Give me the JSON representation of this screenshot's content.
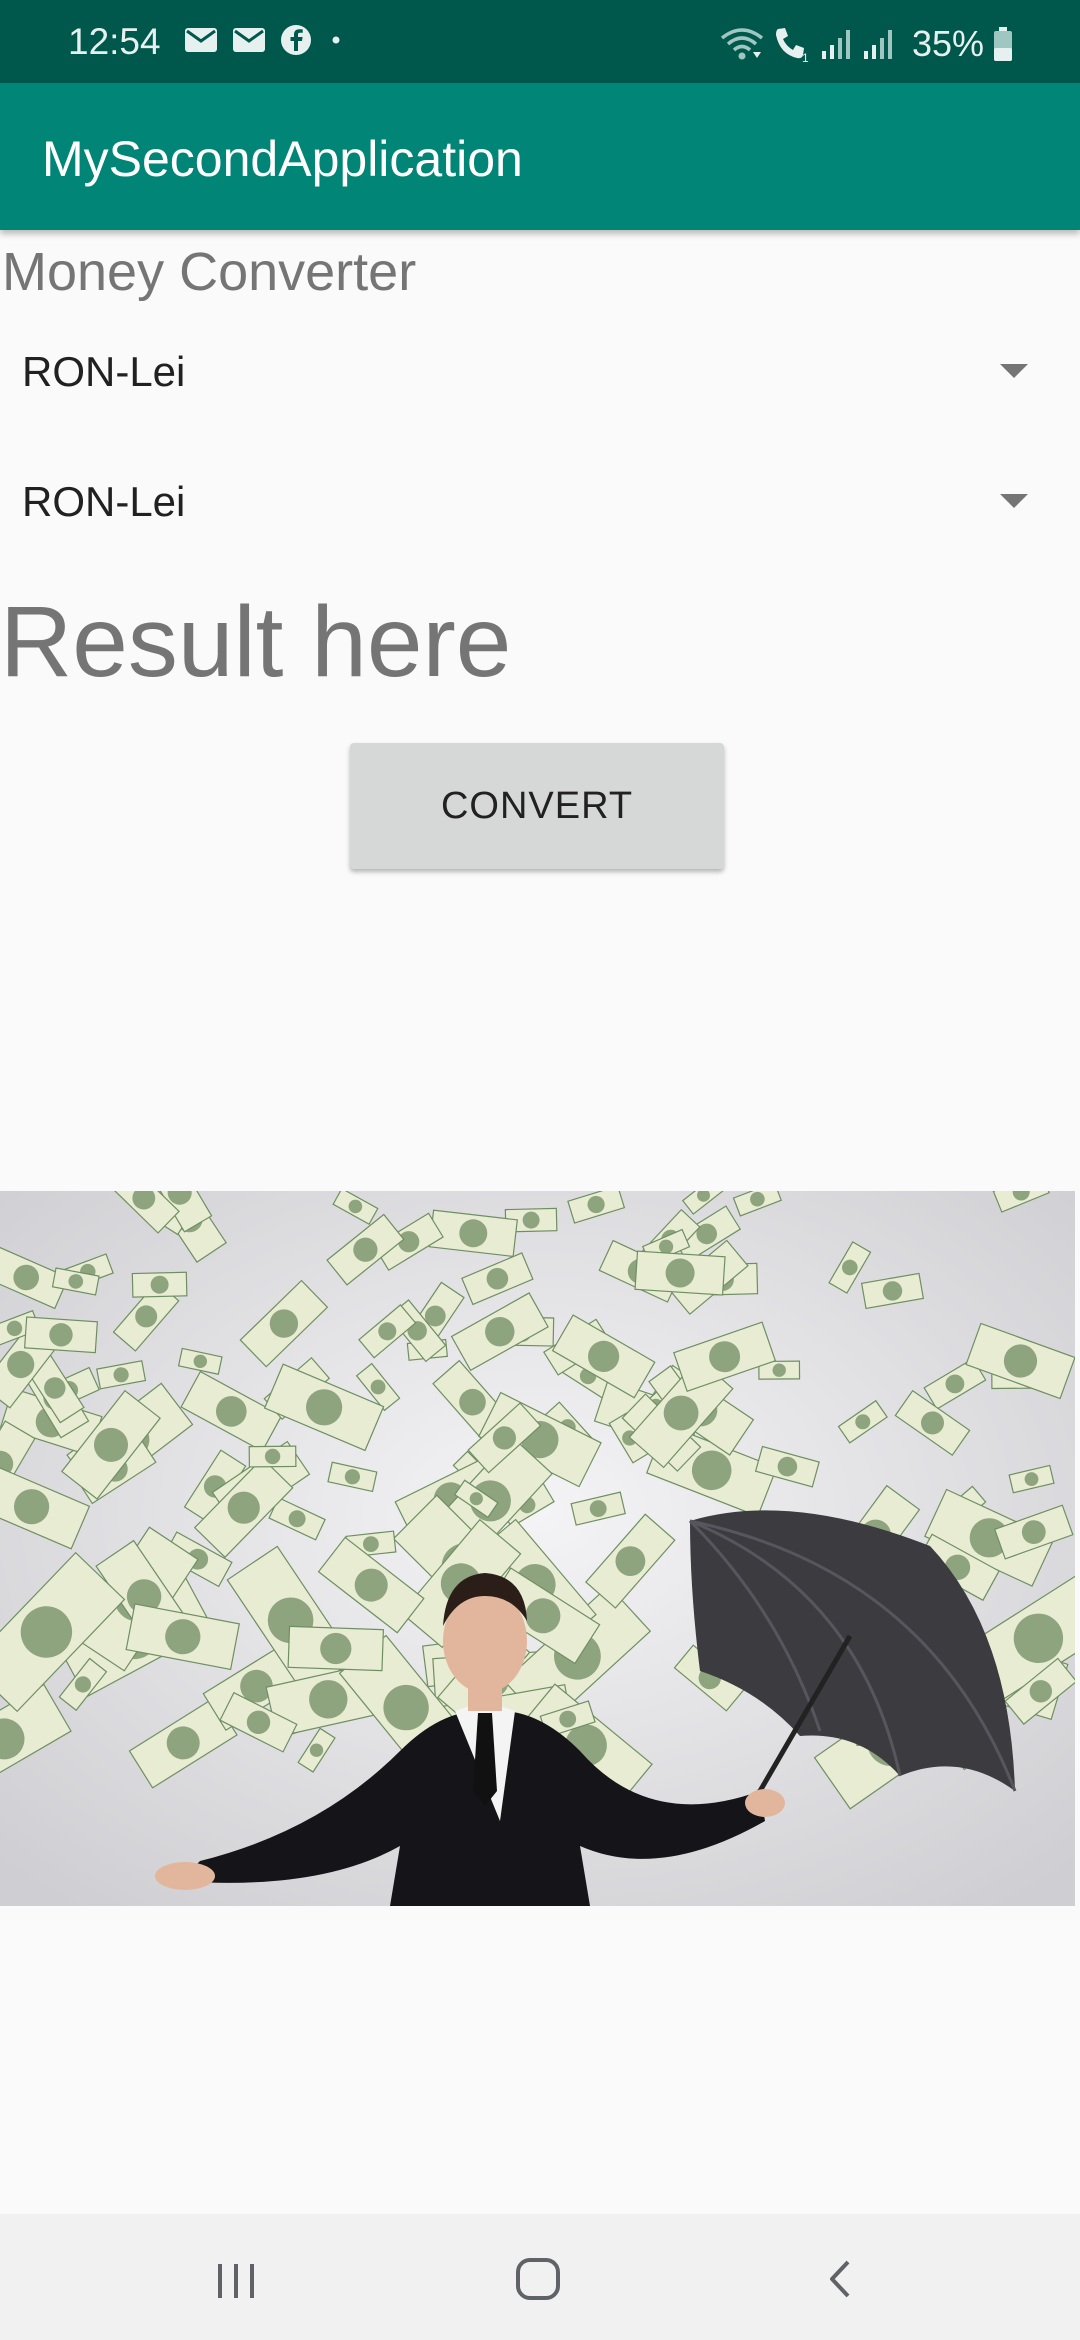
{
  "status_bar": {
    "time": "12:54",
    "battery": "35%",
    "icons_left": [
      "email-icon",
      "email-icon",
      "facebook-icon",
      "dot-icon"
    ],
    "icons_right": [
      "wifi-icon",
      "call-icon",
      "signal-icon",
      "signal-icon",
      "battery-icon"
    ],
    "background": "#00574b"
  },
  "app_bar": {
    "title": "MySecondApplication",
    "background": "#008577"
  },
  "converter": {
    "heading": "Money Converter",
    "from_currency": "RON-Lei",
    "to_currency": "RON-Lei",
    "result": "Result here",
    "convert_label": "CONVERT"
  },
  "image": {
    "subject": "money-rain-businessman-umbrella"
  },
  "nav_bar": {
    "buttons": [
      "recents-icon",
      "home-icon",
      "back-icon"
    ]
  }
}
